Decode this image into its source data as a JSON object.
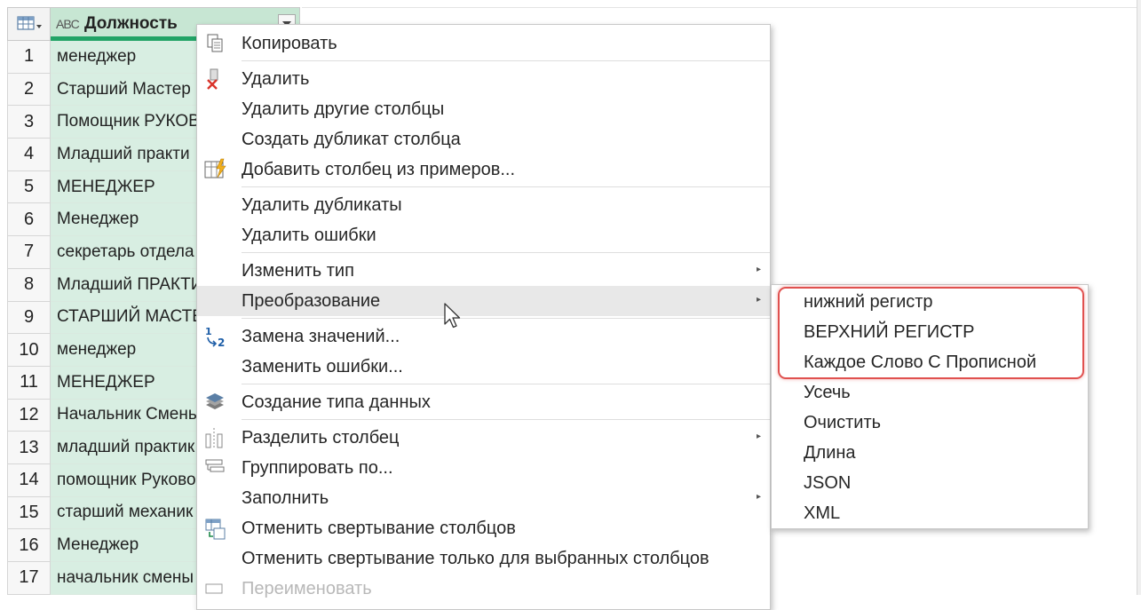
{
  "grid": {
    "column_type_icon": "ABC",
    "column_title": "Должность",
    "rows": [
      {
        "n": "1",
        "v": "менеджер"
      },
      {
        "n": "2",
        "v": "Старший Мастер"
      },
      {
        "n": "3",
        "v": "Помощник РУКОВ"
      },
      {
        "n": "4",
        "v": "Младший практи"
      },
      {
        "n": "5",
        "v": "МЕНЕДЖЕР"
      },
      {
        "n": "6",
        "v": "Менеджер"
      },
      {
        "n": "7",
        "v": "секретарь отдела"
      },
      {
        "n": "8",
        "v": "Младший ПРАКТИ"
      },
      {
        "n": "9",
        "v": "СТАРШИЙ МАСТЕ"
      },
      {
        "n": "10",
        "v": "менеджер"
      },
      {
        "n": "11",
        "v": "МЕНЕДЖЕР"
      },
      {
        "n": "12",
        "v": "Начальник Смень"
      },
      {
        "n": "13",
        "v": "младший практик"
      },
      {
        "n": "14",
        "v": "помощник Руково"
      },
      {
        "n": "15",
        "v": "старший механик"
      },
      {
        "n": "16",
        "v": "Менеджер"
      },
      {
        "n": "17",
        "v": "начальник смены"
      }
    ]
  },
  "menu": {
    "items": [
      {
        "label": "Копировать",
        "icon": "copy-icon"
      },
      {
        "label": "Удалить",
        "icon": "delete-column-icon"
      },
      {
        "label": "Удалить другие столбцы"
      },
      {
        "label": "Создать дубликат столбца"
      },
      {
        "label": "Добавить столбец из примеров...",
        "icon": "column-from-examples-icon"
      },
      {
        "label": "Удалить дубликаты"
      },
      {
        "label": "Удалить ошибки"
      },
      {
        "label": "Изменить тип",
        "submenu": true
      },
      {
        "label": "Преобразование",
        "submenu": true,
        "highlighted": true
      },
      {
        "label": "Замена значений...",
        "icon": "replace-values-icon"
      },
      {
        "label": "Заменить ошибки..."
      },
      {
        "label": "Создание типа данных",
        "icon": "data-type-icon"
      },
      {
        "label": "Разделить столбец",
        "icon": "split-column-icon",
        "submenu": true
      },
      {
        "label": "Группировать по...",
        "icon": "group-by-icon"
      },
      {
        "label": "Заполнить",
        "submenu": true
      },
      {
        "label": "Отменить свертывание столбцов",
        "icon": "unpivot-icon"
      },
      {
        "label": "Отменить свертывание только для выбранных столбцов"
      },
      {
        "label": "Переименовать",
        "icon": "rename-icon",
        "partially_visible": true
      }
    ]
  },
  "submenu": {
    "items": [
      "нижний регистр",
      "ВЕРХНИЙ РЕГИСТР",
      "Каждое Слово С Прописной",
      "Усечь",
      "Очистить",
      "Длина",
      "JSON",
      "XML"
    ],
    "highlight_color": "#e0514f"
  },
  "colors": {
    "column_selected": "#c7e6d3",
    "cell_selected": "#d8eee2",
    "accent": "#21a366",
    "menu_highlight": "#e8e8e8"
  }
}
